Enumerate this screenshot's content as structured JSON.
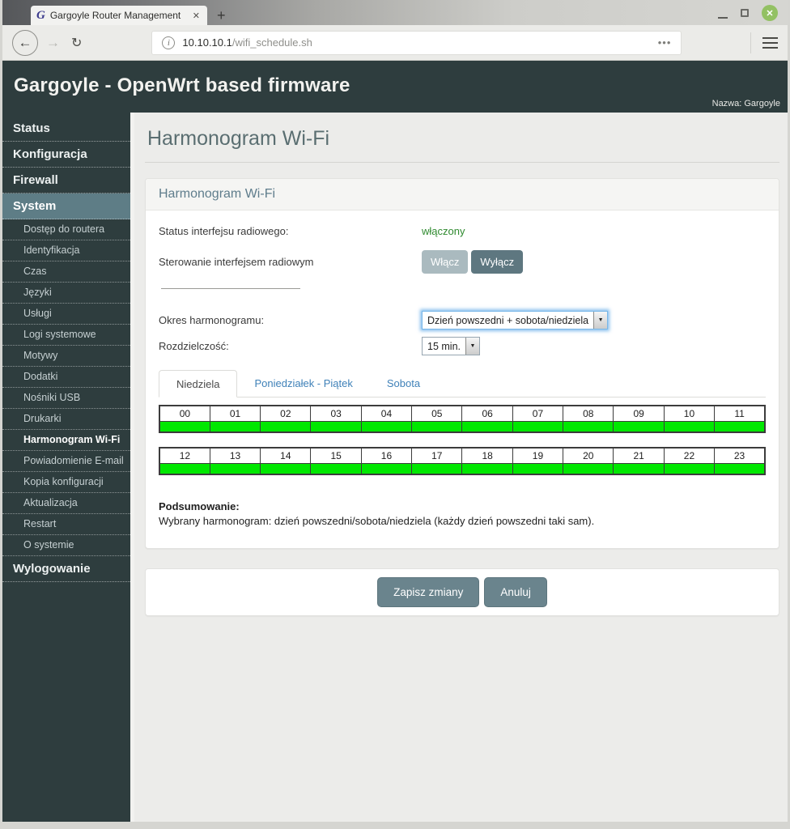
{
  "browser": {
    "tab_title": "Gargoyle Router Management",
    "new_tab_label": "+",
    "url_host": "10.10.10.1",
    "url_path": "/wifi_schedule.sh"
  },
  "header": {
    "title": "Gargoyle - OpenWrt based firmware",
    "router_name": "Nazwa: Gargoyle"
  },
  "sidebar": {
    "items": [
      {
        "label": "Status",
        "type": "top",
        "active": false
      },
      {
        "label": "Konfiguracja",
        "type": "top",
        "active": false
      },
      {
        "label": "Firewall",
        "type": "top",
        "active": false
      },
      {
        "label": "System",
        "type": "top",
        "active": true
      },
      {
        "label": "Dostęp do routera",
        "type": "sub",
        "active": false
      },
      {
        "label": "Identyfikacja",
        "type": "sub",
        "active": false
      },
      {
        "label": "Czas",
        "type": "sub",
        "active": false
      },
      {
        "label": "Języki",
        "type": "sub",
        "active": false
      },
      {
        "label": "Usługi",
        "type": "sub",
        "active": false
      },
      {
        "label": "Logi systemowe",
        "type": "sub",
        "active": false
      },
      {
        "label": "Motywy",
        "type": "sub",
        "active": false
      },
      {
        "label": "Dodatki",
        "type": "sub",
        "active": false
      },
      {
        "label": "Nośniki USB",
        "type": "sub",
        "active": false
      },
      {
        "label": "Drukarki",
        "type": "sub",
        "active": false
      },
      {
        "label": "Harmonogram Wi-Fi",
        "type": "sub",
        "active": true
      },
      {
        "label": "Powiadomienie E-mail",
        "type": "sub",
        "active": false
      },
      {
        "label": "Kopia konfiguracji",
        "type": "sub",
        "active": false
      },
      {
        "label": "Aktualizacja",
        "type": "sub",
        "active": false
      },
      {
        "label": "Restart",
        "type": "sub",
        "active": false
      },
      {
        "label": "O systemie",
        "type": "sub",
        "active": false
      },
      {
        "label": "Wylogowanie",
        "type": "top",
        "active": false
      }
    ]
  },
  "main": {
    "page_title": "Harmonogram Wi-Fi",
    "panel": {
      "title": "Harmonogram Wi-Fi",
      "status_label": "Status interfejsu radiowego:",
      "status_value": "włączony",
      "control_label": "Sterowanie interfejsem radiowym",
      "enable_button": "Włącz",
      "disable_button": "Wyłącz",
      "period_label": "Okres harmonogramu:",
      "period_value": "Dzień powszedni + sobota/niedziela",
      "resolution_label": "Rozdzielczość:",
      "resolution_value": "15 min.",
      "tabs": [
        {
          "label": "Niedziela",
          "active": true
        },
        {
          "label": "Poniedziałek - Piątek",
          "active": false
        },
        {
          "label": "Sobota",
          "active": false
        }
      ],
      "schedule": {
        "rows": [
          [
            "00",
            "01",
            "02",
            "03",
            "04",
            "05",
            "06",
            "07",
            "08",
            "09",
            "10",
            "11"
          ],
          [
            "12",
            "13",
            "14",
            "15",
            "16",
            "17",
            "18",
            "19",
            "20",
            "21",
            "22",
            "23"
          ]
        ],
        "all_enabled": true,
        "enabled_color": "#00e800"
      },
      "summary_label": "Podsumowanie:",
      "summary_text": "Wybrany harmonogram: dzień powszedni/sobota/niedziela (każdy dzień powszedni taki sam)."
    },
    "actions": {
      "save_label": "Zapisz zmiany",
      "cancel_label": "Anuluj"
    }
  },
  "colors": {
    "header_bg": "#2e3d3e",
    "sidebar_active_bg": "#5e7d86",
    "status_green": "#2f8a2f",
    "schedule_green": "#00e800",
    "link_blue": "#3f81b8",
    "button_slate": "#6a848d"
  }
}
